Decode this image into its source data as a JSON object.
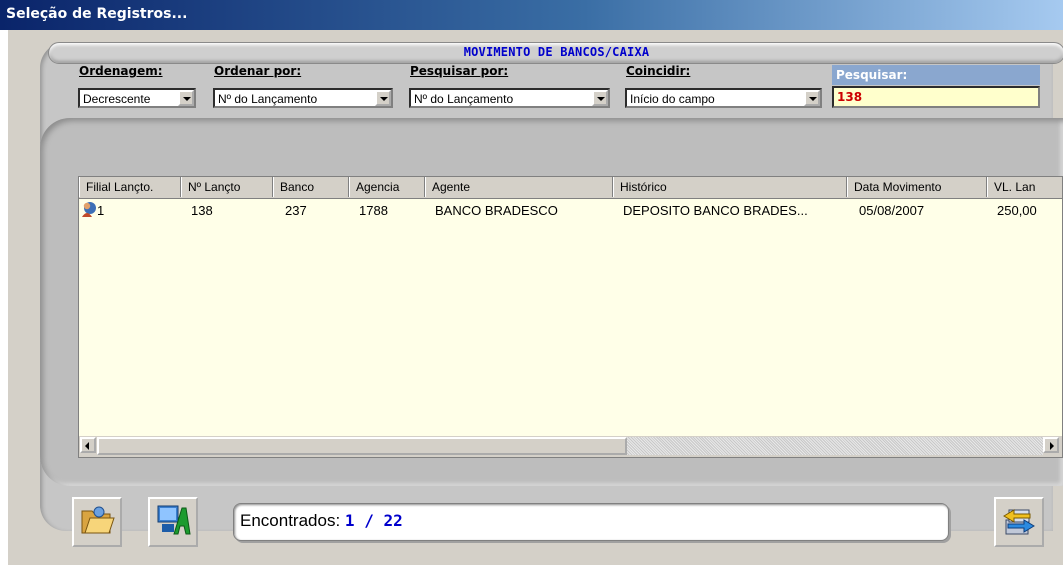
{
  "window": {
    "title": "Seleção de Registros..."
  },
  "header": {
    "caption": "MOVIMENTO DE BANCOS/CAIXA"
  },
  "filters": {
    "ordenagem": {
      "label": "Ordenagem:",
      "value": "Decrescente"
    },
    "ordenar_por": {
      "label": "Ordenar por:",
      "value": "Nº do Lançamento"
    },
    "pesquisar_por": {
      "label": "Pesquisar por:",
      "value": "Nº do Lançamento"
    },
    "coincidir": {
      "label": "Coincidir:",
      "value": "Início do campo"
    },
    "pesquisar": {
      "label": "Pesquisar:",
      "value": "138"
    }
  },
  "grid": {
    "columns": [
      "Filial Lançto.",
      "Nº Lançto",
      "Banco",
      "Agencia",
      "Agente",
      "Histórico",
      "Data Movimento",
      "VL. Lan"
    ],
    "rows": [
      [
        "1",
        "138",
        "237",
        "1788",
        "BANCO BRADESCO",
        "DEPOSITO BANCO BRADES...",
        "05/08/2007",
        "250,00"
      ]
    ]
  },
  "status": {
    "label": "Encontrados:",
    "count": "1 / 22"
  },
  "icons": {
    "open_folder": "folder-open-icon",
    "report": "computer-report-icon",
    "refresh": "refresh-icon",
    "record": "user-record-icon"
  }
}
